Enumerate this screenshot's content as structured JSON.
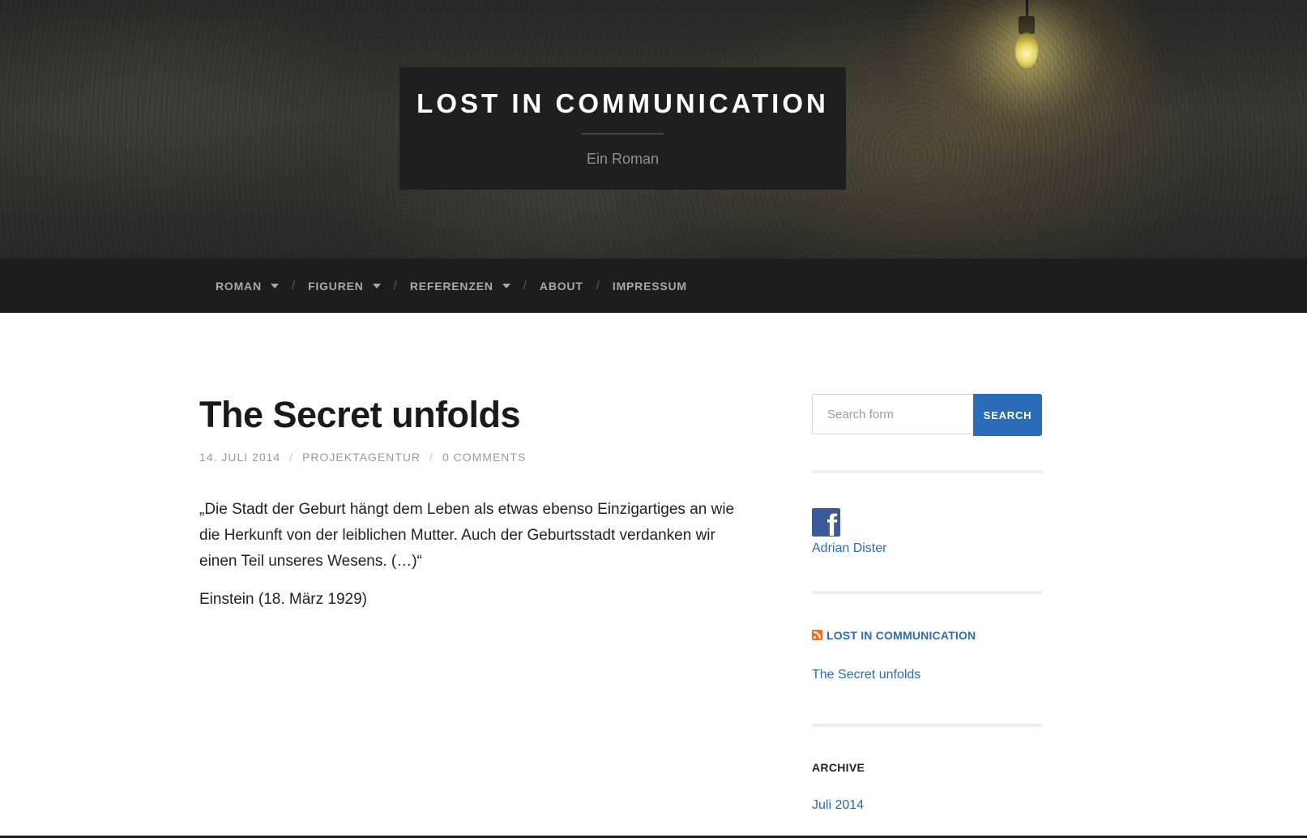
{
  "header": {
    "title": "LOST IN COMMUNICATION",
    "subtitle": "Ein Roman"
  },
  "nav": {
    "items": [
      {
        "label": "ROMAN",
        "has_dropdown": true
      },
      {
        "label": "FIGUREN",
        "has_dropdown": true
      },
      {
        "label": "REFERENZEN",
        "has_dropdown": true
      },
      {
        "label": "ABOUT",
        "has_dropdown": false
      },
      {
        "label": "IMPRESSUM",
        "has_dropdown": false
      }
    ],
    "separator": "/"
  },
  "post": {
    "title": "The Secret unfolds",
    "date": "14. JULI 2014",
    "author": "PROJEKTAGENTUR",
    "comments": "0 COMMENTS",
    "meta_separator": "/",
    "quote": "„Die Stadt der Geburt hängt dem Leben als etwas ebenso Einzigartiges an wie die Herkunft von der leiblichen Mutter. Auch der Geburtsstadt verdanken wir einen Teil unseres Wesens. (…)“",
    "source": "Einstein (18. März 1929)"
  },
  "sidebar": {
    "search": {
      "placeholder": "Search form",
      "value": "",
      "button_label": "SEARCH"
    },
    "facebook": {
      "icon": "facebook-icon",
      "name": "Adrian Dister",
      "color": "#3b5998"
    },
    "rss": {
      "icon": "rss-icon",
      "title": "LOST IN COMMUNICATION",
      "items": [
        "The Secret unfolds"
      ]
    },
    "archive": {
      "title": "ARCHIVE",
      "items": [
        "Juli 2014"
      ]
    }
  },
  "colors": {
    "accent": "#2b6cb8",
    "navbar": "#1d1d1d",
    "title_box": "#1f1f1f"
  }
}
